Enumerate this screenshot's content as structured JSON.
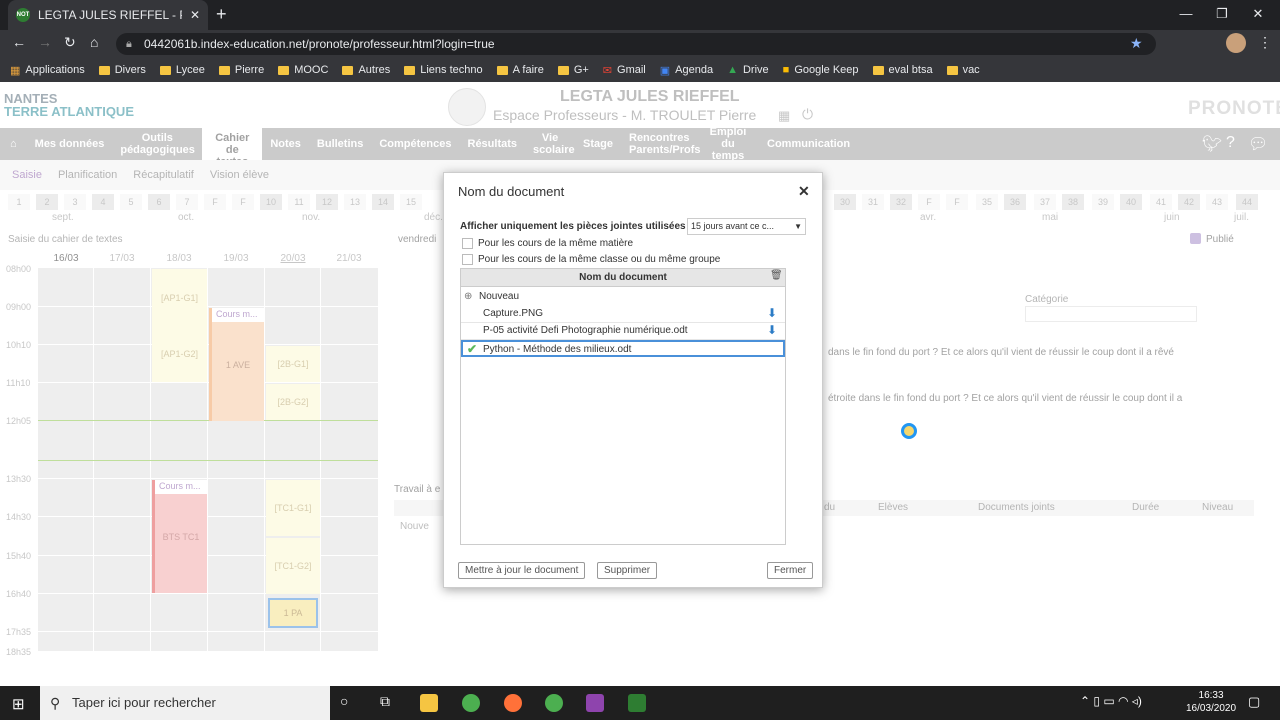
{
  "browser": {
    "tab_title": "LEGTA JULES RIEFFEL - PRONOTE",
    "tab_favicon": "NOT",
    "url": "0442061b.index-education.net/pronote/professeur.html?login=true",
    "bookmarks": [
      "Applications",
      "Divers",
      "Lycee",
      "Pierre",
      "MOOC",
      "Autres",
      "Liens techno",
      "A faire",
      "G+",
      "Gmail",
      "Agenda",
      "Drive",
      "Google Keep",
      "eval btsa",
      "vac"
    ]
  },
  "header": {
    "logo_line1": "NANTES",
    "logo_line2": "TERRE ATLANTIQUE",
    "school": "LEGTA JULES RIEFFEL",
    "space": "Espace Professeurs - M. TROULET Pierre",
    "brand": "PRONOTE"
  },
  "menu": [
    "Mes données",
    "Outils pédagogiques",
    "Cahier de textes",
    "Notes",
    "Bulletins",
    "Compétences",
    "Résultats",
    "Vie scolaire",
    "Stage",
    "Rencontres Parents/Profs",
    "Emploi du temps",
    "Communication"
  ],
  "submenu": [
    "Saisie",
    "Planification",
    "Récapitulatif",
    "Vision élève"
  ],
  "weeks_left": [
    "1",
    "2",
    "3",
    "4",
    "5",
    "6",
    "7",
    "F",
    "F",
    "10",
    "11",
    "12",
    "13",
    "14",
    "15"
  ],
  "weeks_right": [
    "30",
    "31",
    "32",
    "F",
    "F",
    "35",
    "36",
    "37",
    "38",
    "39",
    "40",
    "41",
    "42",
    "43",
    "44"
  ],
  "months": [
    "sept.",
    "oct.",
    "nov.",
    "déc.",
    "avr.",
    "mai",
    "juin",
    "juil."
  ],
  "agenda": {
    "title": "Saisie du cahier de textes",
    "days": [
      "16/03",
      "17/03",
      "18/03",
      "19/03",
      "20/03",
      "21/03"
    ],
    "hours": [
      "08h00",
      "09h00",
      "10h10",
      "11h10",
      "12h05",
      "13h30",
      "14h30",
      "15h40",
      "16h40",
      "17h35",
      "18h35"
    ],
    "courses": {
      "ap1g1": "[AP1-G1]",
      "ap1g2": "[AP1-G2]",
      "cours_m": "Cours m...",
      "ave": "1 AVE",
      "b2g1": "[2B-G1]",
      "b2g2": "[2B-G2]",
      "btstc1": "BTS TC1",
      "tc1g1": "[TC1-G1]",
      "tc1g2": "[TC1-G2]",
      "pa": "1 PA"
    }
  },
  "right_panel": {
    "date": "vendredi",
    "published": "Publié",
    "category": "Catégorie",
    "text1": "dans le fin fond du port ? Et ce alors qu'il vient de réussir le coup dont il a rêvé",
    "text2": "étroite dans le fin fond du port ? Et ce alors qu'il vient de réussir le coup dont il a",
    "work": "Travail à e",
    "new": "Nouve",
    "cols": [
      "du",
      "Elèves",
      "Documents joints",
      "Durée",
      "Niveau"
    ]
  },
  "dialog": {
    "title": "Nom du document",
    "filter_label": "Afficher uniquement les pièces jointes utilisées",
    "filter_value": "15 jours avant ce c...",
    "opt1": "Pour les cours de la même matière",
    "opt2": "Pour les cours de la même classe ou du même groupe",
    "col_header": "Nom du document",
    "new_label": "Nouveau",
    "files": [
      "Capture.PNG",
      "P-05 activité Defi Photographie numérique.odt",
      "Python - Méthode des milieux.odt"
    ],
    "btn_update": "Mettre à jour le document",
    "btn_delete": "Supprimer",
    "btn_close": "Fermer"
  },
  "taskbar": {
    "search_placeholder": "Taper ici pour rechercher",
    "time": "16:33",
    "date": "16/03/2020"
  }
}
